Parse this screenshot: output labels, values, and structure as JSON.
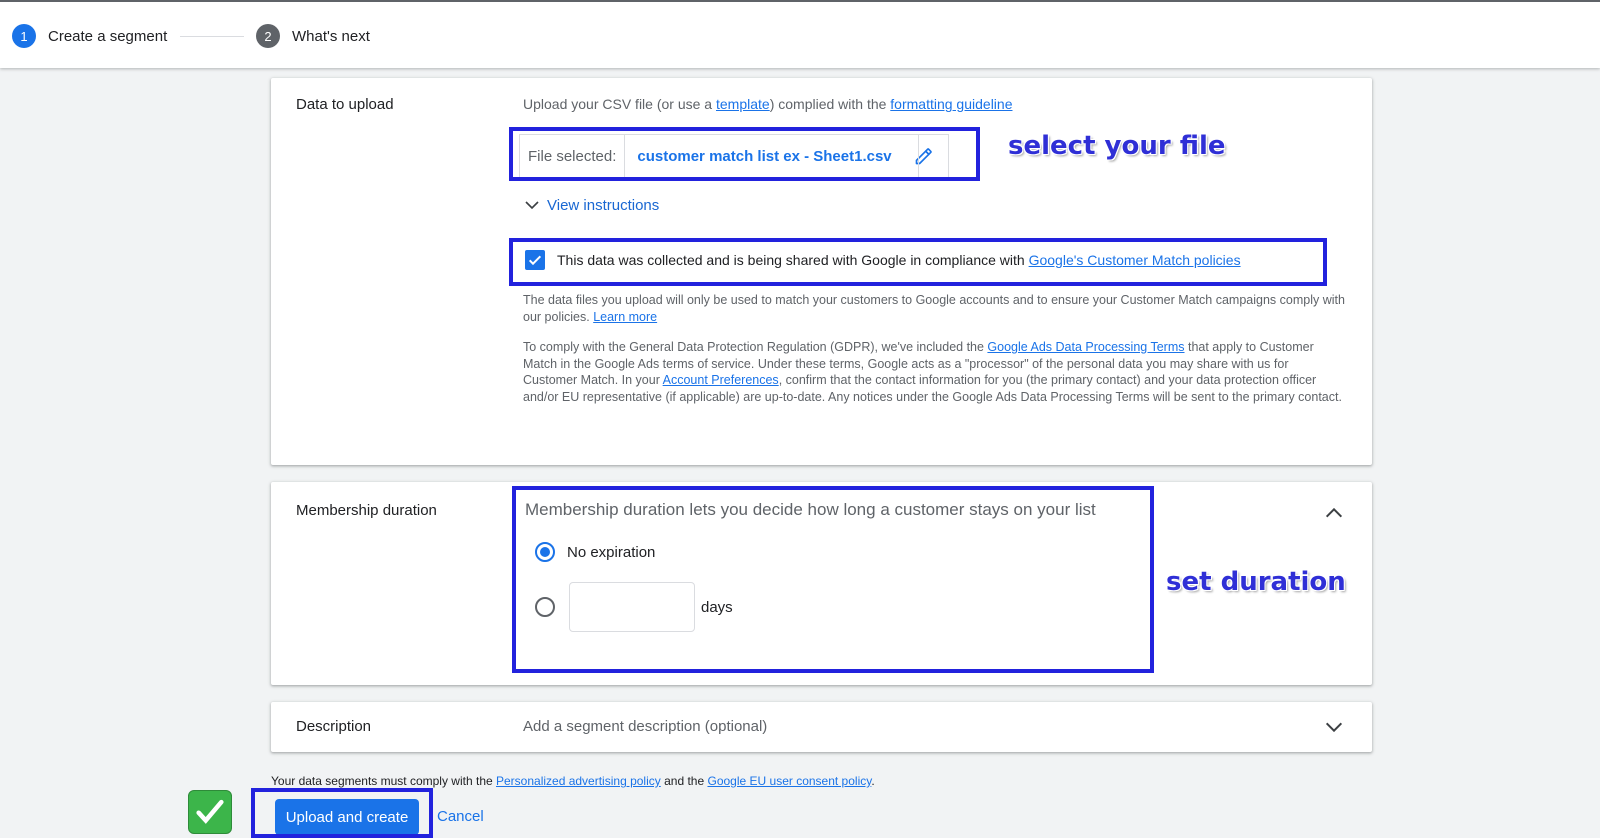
{
  "stepper": {
    "step1": {
      "number": "1",
      "label": "Create a segment"
    },
    "step2": {
      "number": "2",
      "label": "What's next"
    }
  },
  "data_upload": {
    "section_label": "Data to upload",
    "hint_prefix": "Upload your CSV file (or use a ",
    "template_link": "template",
    "hint_middle": ") complied with the ",
    "guideline_link": "formatting guideline",
    "file_label": "File selected:",
    "file_name": "customer match list ex - Sheet1.csv",
    "view_instructions": "View instructions",
    "consent_text": "This data was collected and is being shared with Google in compliance with ",
    "consent_link": "Google's Customer Match policies",
    "consent_checked": true,
    "usage_text": "The data files you upload will only be used to match your customers to Google accounts and to ensure your Customer Match campaigns comply with our policies. ",
    "learn_more": "Learn more",
    "gdpr_1": "To comply with the General Data Protection Regulation (GDPR), we've included the ",
    "gdpr_link1": "Google Ads Data Processing Terms",
    "gdpr_2": " that apply to Customer Match in the Google Ads terms of service. Under these terms, Google acts as a \"processor\" of the personal data you may share with us for Customer Match. In your ",
    "gdpr_link2": "Account Preferences",
    "gdpr_3": ", confirm that the contact information for you (the primary contact) and your data protection officer and/or EU representative (if applicable) are up-to-date. Any notices under the Google Ads Data Processing Terms will be sent to the primary contact."
  },
  "membership": {
    "section_label": "Membership duration",
    "title": "Membership duration lets you decide how long a customer stays on your list",
    "option_no_expiration": "No expiration",
    "option_days_unit": "days",
    "selected": "No expiration",
    "days_value": ""
  },
  "description": {
    "section_label": "Description",
    "placeholder": "Add a segment description (optional)"
  },
  "footer": {
    "note_prefix": "Your data segments must comply with the ",
    "link1": "Personalized advertising policy",
    "note_middle": " and the ",
    "link2": "Google EU user consent policy",
    "note_suffix": ".",
    "primary_button": "Upload and create",
    "cancel_button": "Cancel"
  },
  "annotations": {
    "file": "select your file",
    "duration": "set duration"
  },
  "colors": {
    "accent": "#1a73e8",
    "annotation": "#2222dd",
    "step_inactive": "#5f6368"
  }
}
